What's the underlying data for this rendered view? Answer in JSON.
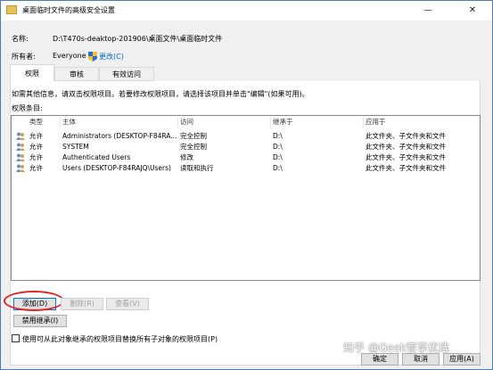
{
  "window": {
    "title": "桌面临时文件的高级安全设置",
    "minimize_glyph": "—",
    "close_glyph": "✕"
  },
  "info": {
    "name_label": "名称:",
    "name_value": "D:\\T470s-deaktop-201906\\桌面文件\\桌面临时文件",
    "owner_label": "所有者:",
    "owner_value": "Everyone",
    "change_link": "更改(C)"
  },
  "tabs": [
    {
      "label": "权限",
      "active": true
    },
    {
      "label": "审核",
      "active": false
    },
    {
      "label": "有效访问",
      "active": false
    }
  ],
  "instructions": "如需其他信息，请双击权限项目。若要修改权限项目，请选择该项目并单击\"编辑\"(如果可用)。",
  "entries_label": "权限条目:",
  "columns": [
    "类型",
    "主体",
    "访问",
    "继承于",
    "应用于"
  ],
  "rows": [
    {
      "type": "允许",
      "principal": "Administrators (DESKTOP-F84RA...",
      "access": "完全控制",
      "inherited": "D:\\",
      "applies": "此文件夹、子文件夹和文件"
    },
    {
      "type": "允许",
      "principal": "SYSTEM",
      "access": "完全控制",
      "inherited": "D:\\",
      "applies": "此文件夹、子文件夹和文件"
    },
    {
      "type": "允许",
      "principal": "Authenticated Users",
      "access": "修改",
      "inherited": "D:\\",
      "applies": "此文件夹、子文件夹和文件"
    },
    {
      "type": "允许",
      "principal": "Users (DESKTOP-F84RAJQ\\Users)",
      "access": "读取和执行",
      "inherited": "D:\\",
      "applies": "此文件夹、子文件夹和文件"
    }
  ],
  "buttons": {
    "add": "添加(D)",
    "remove": "删除(R)",
    "view": "查看(V)",
    "disable_inheritance": "禁用继承(I)",
    "ok": "确定",
    "cancel": "取消",
    "apply": "应用(A)"
  },
  "replace_checkbox_label": "使用可从此对象继承的权限项目替换所有子对象的权限项目(P)",
  "watermark": "知乎 @Geek智享优选",
  "colors": {
    "highlight_circle": "#e02424",
    "link": "#0066cc",
    "accent_border": "#0078d7"
  }
}
